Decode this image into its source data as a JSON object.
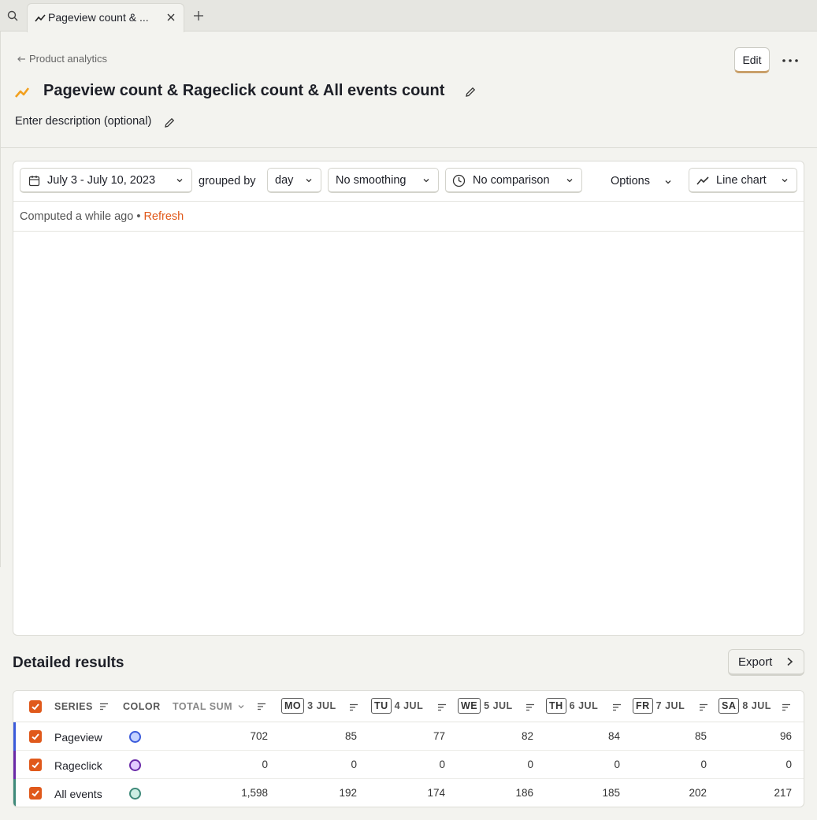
{
  "tabbar": {
    "tab_title": "Pageview count & ...",
    "icons": {
      "search": "search-icon",
      "tab": "trend-icon",
      "close": "close-icon",
      "new_tab": "plus-icon"
    }
  },
  "header": {
    "breadcrumb": "Product analytics",
    "edit_label": "Edit",
    "title": "Pageview count & Rageclick count & All events count",
    "description_placeholder": "Enter description (optional)",
    "accent_color": "#f2a01f"
  },
  "controls": {
    "date_range": "July 3 - July 10, 2023",
    "grouped_by_label": "grouped by",
    "interval": "day",
    "smoothing": "No smoothing",
    "comparison": "No comparison",
    "options_label": "Options",
    "chart_type": "Line chart"
  },
  "status": {
    "computed_text": "Computed a while ago",
    "separator": "•",
    "refresh_label": "Refresh",
    "refresh_color": "#e0591b"
  },
  "results": {
    "title": "Detailed results",
    "export_label": "Export",
    "columns": {
      "series": "SERIES",
      "color": "COLOR",
      "total": "TOTAL SUM",
      "days": [
        {
          "abbr": "MO",
          "date": "3 JUL"
        },
        {
          "abbr": "TU",
          "date": "4 JUL"
        },
        {
          "abbr": "WE",
          "date": "5 JUL"
        },
        {
          "abbr": "TH",
          "date": "6 JUL"
        },
        {
          "abbr": "FR",
          "date": "7 JUL"
        },
        {
          "abbr": "SA",
          "date": "8 JUL"
        }
      ]
    },
    "rows": [
      {
        "name": "Pageview",
        "color": "#3b5bdb",
        "fill": "#c5d3ff",
        "total": "702",
        "values": [
          "85",
          "77",
          "82",
          "84",
          "85",
          "96"
        ]
      },
      {
        "name": "Rageclick",
        "color": "#6a2aa8",
        "fill": "#e2cbff",
        "total": "0",
        "values": [
          "0",
          "0",
          "0",
          "0",
          "0",
          "0"
        ]
      },
      {
        "name": "All events",
        "color": "#3f8a7a",
        "fill": "#cdeee4",
        "total": "1,598",
        "values": [
          "192",
          "174",
          "186",
          "185",
          "202",
          "217"
        ]
      }
    ]
  }
}
